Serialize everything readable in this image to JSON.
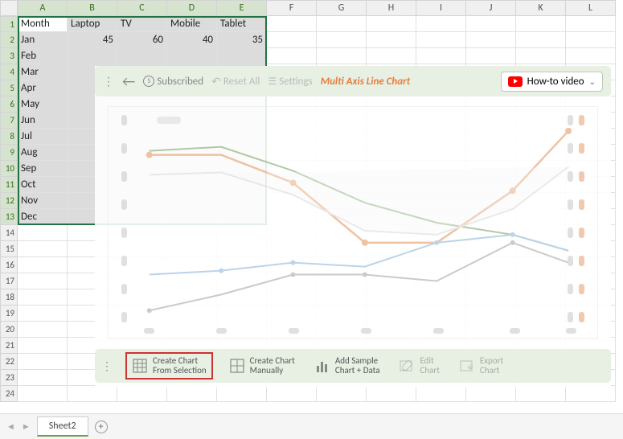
{
  "columns": [
    "A",
    "B",
    "C",
    "D",
    "E",
    "F",
    "G",
    "H",
    "I",
    "J",
    "K",
    "L"
  ],
  "grid": {
    "headers": [
      "Month",
      "Laptop",
      "TV",
      "Mobile",
      "Tablet"
    ],
    "rows": [
      {
        "m": "Jan",
        "v": [
          "45",
          "60",
          "40",
          "35"
        ]
      },
      {
        "m": "Feb",
        "v": [
          "",
          "",
          "",
          ""
        ]
      },
      {
        "m": "Mar",
        "v": [
          "",
          "",
          "",
          ""
        ]
      },
      {
        "m": "Apr",
        "v": [
          "",
          "",
          "",
          ""
        ]
      },
      {
        "m": "May",
        "v": [
          "",
          "",
          "",
          ""
        ]
      },
      {
        "m": "Jun",
        "v": [
          "",
          "",
          "",
          ""
        ]
      },
      {
        "m": "Jul",
        "v": [
          "",
          "",
          "",
          ""
        ]
      },
      {
        "m": "Aug",
        "v": [
          "",
          "",
          "",
          ""
        ]
      },
      {
        "m": "Sep",
        "v": [
          "",
          "",
          "",
          ""
        ]
      },
      {
        "m": "Oct",
        "v": [
          "",
          "",
          "",
          ""
        ]
      },
      {
        "m": "Nov",
        "v": [
          "",
          "",
          "",
          ""
        ]
      },
      {
        "m": "Dec",
        "v": [
          "",
          "",
          "",
          ""
        ]
      }
    ]
  },
  "toolbar": {
    "subscribed": "Subscribed",
    "reset": "Reset All",
    "settings": "Settings",
    "title": "Multi Axis Line Chart",
    "howto": "How-to video"
  },
  "buttons": {
    "b1a": "Create Chart",
    "b1b": "From Selection",
    "b2a": "Create Chart",
    "b2b": "Manually",
    "b3a": "Add Sample",
    "b3b": "Chart + Data",
    "b4a": "Edit",
    "b4b": "Chart",
    "b5a": "Export",
    "b5b": "Chart"
  },
  "sheet_tab": "Sheet2"
}
